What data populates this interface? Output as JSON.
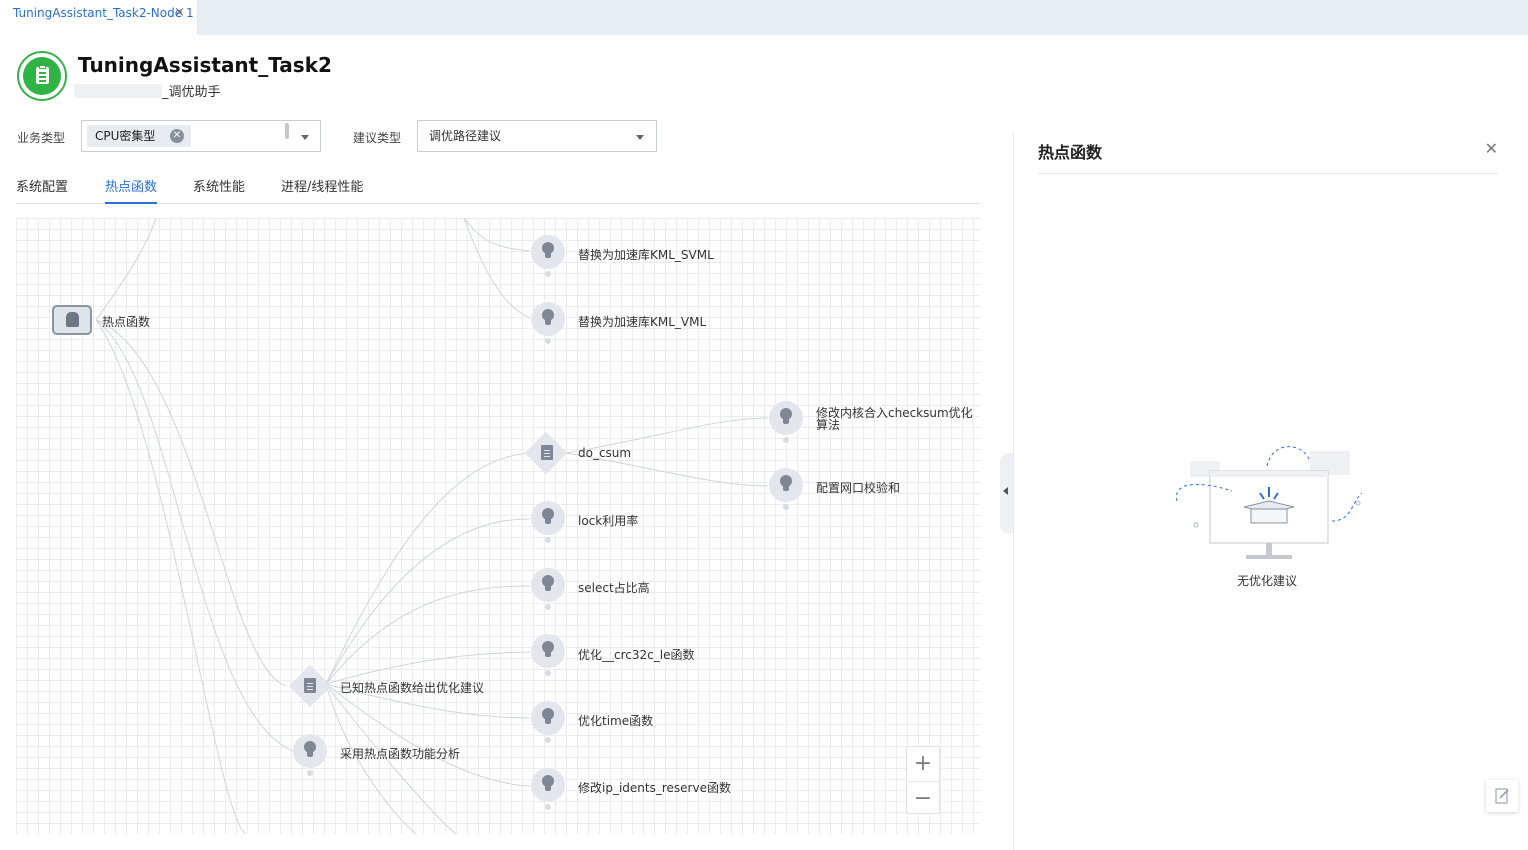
{
  "tab": {
    "label": "TuningAssistant_Task2-Node 1",
    "close": "×"
  },
  "header": {
    "title": "TuningAssistant_Task2",
    "subtitle": "_调优助手",
    "app_icon": "clipboard-icon",
    "icon_color": "#2fb344"
  },
  "filters": {
    "business_type_label": "业务类型",
    "business_type_value": "CPU密集型",
    "advice_type_label": "建议类型",
    "advice_type_value": "调优路径建议"
  },
  "nav_tabs": [
    {
      "label": "系统配置",
      "active": false
    },
    {
      "label": "热点函数",
      "active": true
    },
    {
      "label": "系统性能",
      "active": false
    },
    {
      "label": "进程/线程性能",
      "active": false
    }
  ],
  "graph": {
    "root": {
      "label": "热点函数",
      "icon": "hotspot-icon"
    },
    "nodes": [
      {
        "label": "替换为加速库KML_SVML",
        "icon": "lightbulb-icon"
      },
      {
        "label": "替换为加速库KML_VML",
        "icon": "lightbulb-icon"
      },
      {
        "label": "修改内核合入checksum优化算法",
        "icon": "lightbulb-icon"
      },
      {
        "label": "do_csum",
        "icon": "document-icon"
      },
      {
        "label": "配置网口校验和",
        "icon": "lightbulb-icon"
      },
      {
        "label": "lock利用率",
        "icon": "lightbulb-icon"
      },
      {
        "label": "select占比高",
        "icon": "lightbulb-icon"
      },
      {
        "label": "优化__crc32c_le函数",
        "icon": "lightbulb-icon"
      },
      {
        "label": "已知热点函数给出优化建议",
        "icon": "document-icon"
      },
      {
        "label": "优化time函数",
        "icon": "lightbulb-icon"
      },
      {
        "label": "采用热点函数功能分析",
        "icon": "lightbulb-icon"
      },
      {
        "label": "修改ip_idents_reserve函数",
        "icon": "lightbulb-icon"
      }
    ],
    "zoom_in": "+",
    "zoom_out": "−"
  },
  "panel": {
    "title": "热点函数",
    "close": "✕",
    "empty_text": "无优化建议",
    "illustration": "empty-monitor-illustration"
  },
  "accent": "#2b6fd6"
}
